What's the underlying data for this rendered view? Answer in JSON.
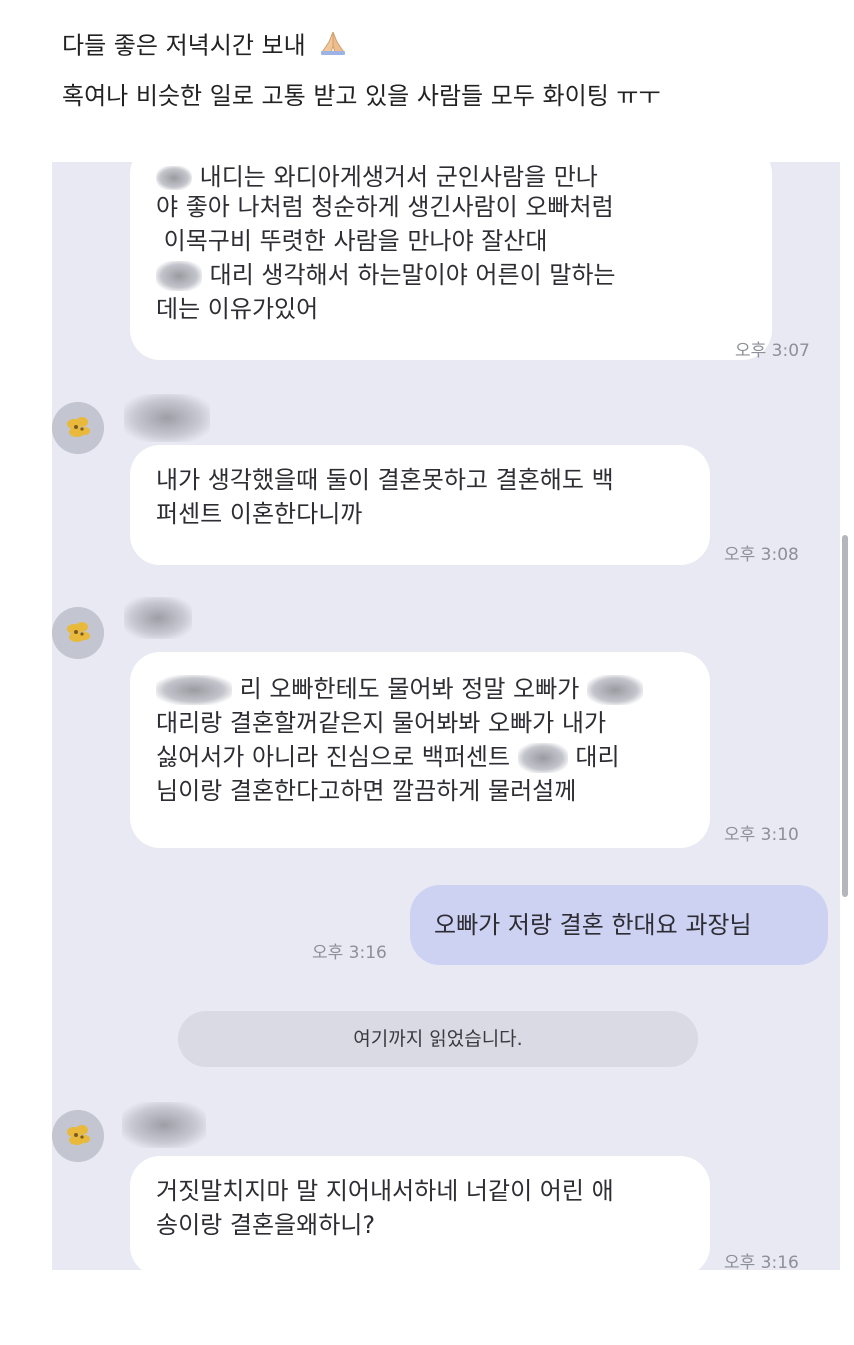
{
  "post": {
    "line1": "다들 좋은 저녁시간 보내",
    "line2": "혹여나 비슷한 일로 고통 받고 있을 사람들 모두 화이팅 ㅠㅜ"
  },
  "chat": {
    "messages": [
      {
        "lines": [
          "내디는 와디아게생거서 군인사람을 만나",
          "야 좋아 나처럼 청순하게 생긴사람이 오빠처럼",
          " 이목구비 뚜렷한 사람을 만나야 잘산대",
          "대리 생각해서 하는말이야 어른이 말하는",
          "데는 이유가있어"
        ],
        "time": "오후 3:07"
      },
      {
        "lines": [
          "내가 생각했을때 둘이 결혼못하고 결혼해도 백",
          "퍼센트 이혼한다니까"
        ],
        "time": "오후 3:08"
      },
      {
        "lines": [
          "리 오빠한테도 물어봐 정말 오빠가",
          "대리랑 결혼할꺼같은지 물어봐봐 오빠가 내가",
          "싫어서가 아니라 진심으로 백퍼센트",
          "대리",
          "님이랑 결혼한다고하면 깔끔하게 물러설께"
        ],
        "time": "오후 3:10"
      },
      {
        "lines": [
          "오빠가 저랑 결혼 한대요 과장님"
        ],
        "time": "오후 3:16"
      },
      {
        "lines": [
          "거짓말치지마 말 지어내서하네 너같이 어린 애",
          "송이랑 결혼을왜하니?"
        ],
        "time": "오후 3:16"
      }
    ],
    "read_marker": "여기까지 읽었습니다."
  },
  "colors": {
    "chat_background": "#e8e9f2",
    "received_bubble": "#ffffff",
    "sent_bubble": "#cdd2f3",
    "read_pill": "#d9dae3"
  },
  "icons": [
    "folded-hands-icon",
    "contact-avatar"
  ]
}
